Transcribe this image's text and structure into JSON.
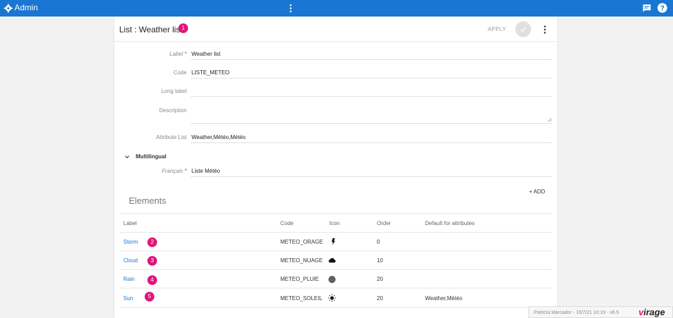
{
  "topbar": {
    "app_title": "Admin"
  },
  "header": {
    "title": "List : Weather list",
    "badge": "1",
    "apply_label": "APPLY"
  },
  "form": {
    "label": {
      "label": "Label",
      "required": "*",
      "value": "Weather list"
    },
    "code": {
      "label": "Code",
      "value": "LISTE_METEO"
    },
    "long_label": {
      "label": "Long label",
      "value": ""
    },
    "description": {
      "label": "Description",
      "value": ""
    },
    "attribute_list": {
      "label": "Attribute List",
      "value": "Weather,Météo,Météo"
    }
  },
  "multilingual": {
    "title": "Multilingual",
    "francais": {
      "label": "Français",
      "required": "*",
      "value": "Liste Météo"
    }
  },
  "elements": {
    "title": "Elements",
    "add_label": "+ ADD",
    "columns": {
      "label": "Label",
      "code": "Code",
      "icon": "Icon",
      "order": "Order",
      "default": "Default for attributes"
    },
    "rows": [
      {
        "label": "Storm",
        "badge": "2",
        "code": "METEO_ORAGE",
        "icon": "lightning-icon",
        "order": "0",
        "default": ""
      },
      {
        "label": "Cloud",
        "badge": "3",
        "code": "METEO_NUAGE",
        "icon": "cloud-icon",
        "order": "10",
        "default": ""
      },
      {
        "label": "Rain",
        "badge": "4",
        "code": "METEO_PLUIE",
        "icon": "circle-icon",
        "order": "20",
        "default": ""
      },
      {
        "label": "Sun",
        "badge": "5",
        "code": "METEO_SOLEIL",
        "icon": "sun-icon",
        "order": "20",
        "default": "Weather,Météo"
      }
    ]
  },
  "footer": {
    "info": "Patricia Marcador - 16/7/21 10:19 - v6.5",
    "brand_prefix": "v",
    "brand_rest": "irage"
  },
  "colors": {
    "topbar": "#1976d2",
    "accent": "#e0157a",
    "link": "#1976d2"
  }
}
